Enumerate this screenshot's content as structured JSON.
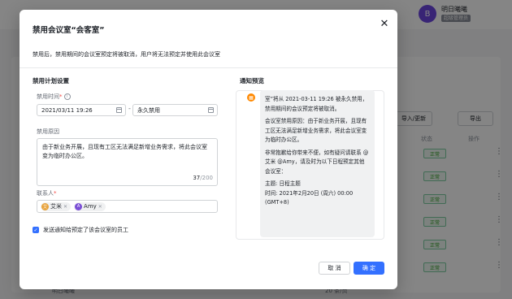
{
  "background": {
    "user_name": "明日曦曦",
    "user_role": "超级管理员",
    "avatar_letter": "B",
    "import_export_label": "导入/更新",
    "export_label": "导出",
    "status_header": "状态",
    "action_header": "操作",
    "status_label": "正常",
    "footer_room": "明日曦曦",
    "pager_text": "20 条/页"
  },
  "modal": {
    "title": "禁用会议室“会客室”",
    "description": "禁用后，禁用期间的会议室预定将被取消，用户将无法预定并使用此会议室",
    "plan_section_title": "禁用计划设置",
    "time_label": "禁用时间",
    "start_time": "2021/03/11 19:26",
    "range_sep": "-",
    "end_time": "永久禁用",
    "reason_label": "禁用原因",
    "reason_text": "由于新业务开展，且现有工区无法满足新增业务需求，将此会议室变为临时办公区。",
    "reason_count": "37",
    "reason_max": "/200",
    "contacts_label": "联系人",
    "contacts": [
      {
        "name": "艾米",
        "color": "#e8a33c"
      },
      {
        "name": "Amy",
        "color": "#7b4fd6"
      }
    ],
    "notify_checkbox_label": "发送通知给预定了该会议室的员工",
    "preview_section_title": "通知预览",
    "preview_paragraphs": [
      "室”将从 2021-03-11 19:26 被永久禁用，禁用期间的会议预定将被取消。",
      "会议室禁用原因：由于新业务开展，且现有工区无法满足新增业务需求，将此会议室变为临时办公区。",
      "非常抱歉给你带来不便，如有疑问请联系 @艾米 @Amy，请及时为以下日程预定其他会议室：",
      "主题: 日程主题\n时间: 2021年2月20日 (周六) 00:00 (GMT+8)"
    ],
    "cancel_label": "取 消",
    "confirm_label": "确 定"
  },
  "colors": {
    "primary": "#3370ff",
    "required": "#f54a45",
    "status_green": "#2ea121"
  }
}
